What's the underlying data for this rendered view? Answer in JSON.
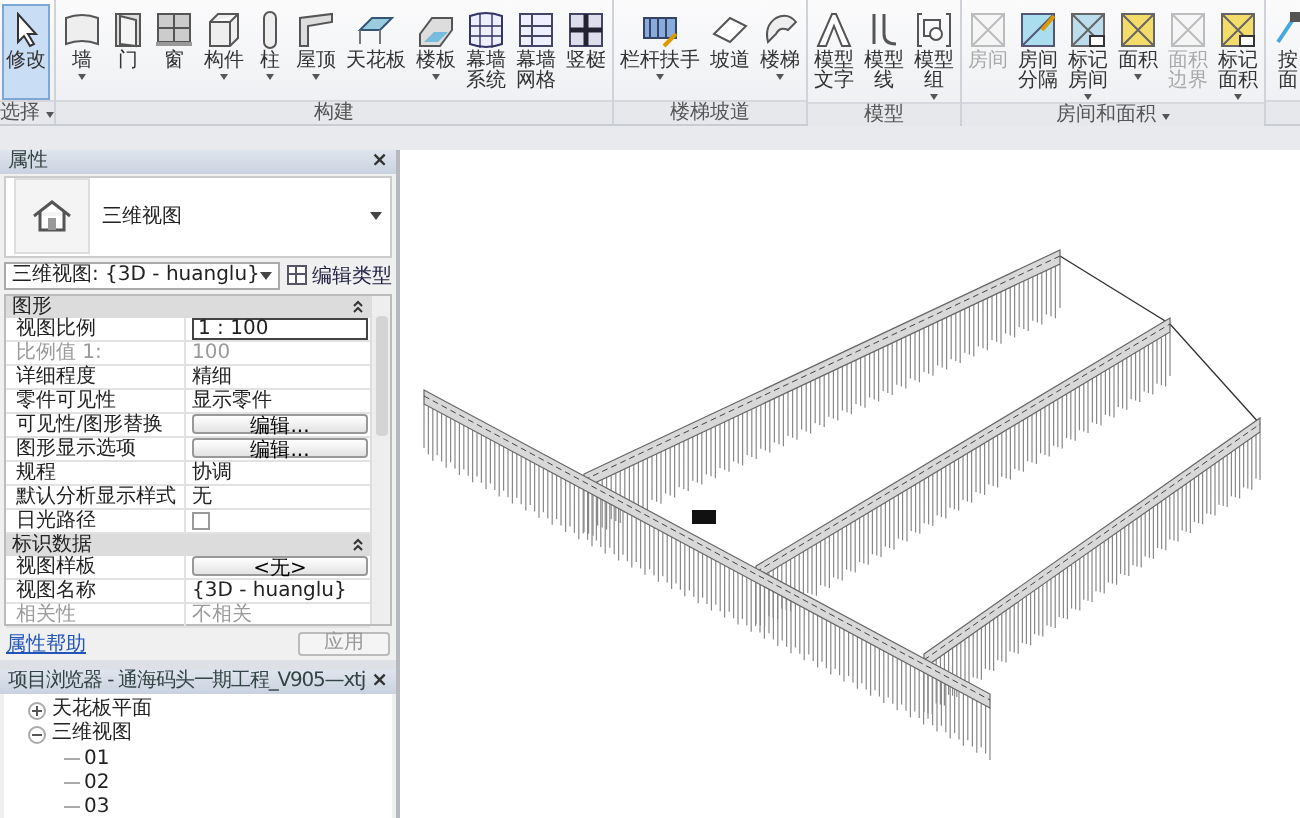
{
  "ribbon": {
    "groups": [
      {
        "label": "选择",
        "dropdown": true,
        "items": [
          {
            "label": [
              "修改"
            ],
            "selected": true,
            "disabled": false,
            "dropdown": false
          }
        ]
      },
      {
        "label": "构建",
        "items": [
          {
            "label": [
              "墙"
            ],
            "selected": false,
            "disabled": false,
            "dropdown": true
          },
          {
            "label": [
              "门"
            ],
            "selected": false,
            "disabled": false,
            "dropdown": false
          },
          {
            "label": [
              "窗"
            ],
            "selected": false,
            "disabled": false,
            "dropdown": false
          },
          {
            "label": [
              "构件"
            ],
            "selected": false,
            "disabled": false,
            "dropdown": true
          },
          {
            "label": [
              "柱"
            ],
            "selected": false,
            "disabled": false,
            "dropdown": true
          },
          {
            "label": [
              "屋顶"
            ],
            "selected": false,
            "disabled": false,
            "dropdown": true
          },
          {
            "label": [
              "天花板"
            ],
            "selected": false,
            "disabled": false,
            "dropdown": false
          },
          {
            "label": [
              "楼板"
            ],
            "selected": false,
            "disabled": false,
            "dropdown": true
          },
          {
            "label": [
              "幕墙",
              "系统"
            ],
            "selected": false,
            "disabled": false,
            "dropdown": false
          },
          {
            "label": [
              "幕墙",
              "网格"
            ],
            "selected": false,
            "disabled": false,
            "dropdown": false
          },
          {
            "label": [
              "竖梃"
            ],
            "selected": false,
            "disabled": false,
            "dropdown": false
          }
        ]
      },
      {
        "label": "楼梯坡道",
        "items": [
          {
            "label": [
              "栏杆扶手"
            ],
            "selected": false,
            "disabled": false,
            "dropdown": true
          },
          {
            "label": [
              "坡道"
            ],
            "selected": false,
            "disabled": false,
            "dropdown": false
          },
          {
            "label": [
              "楼梯"
            ],
            "selected": false,
            "disabled": false,
            "dropdown": true
          }
        ]
      },
      {
        "label": "模型",
        "items": [
          {
            "label": [
              "模型",
              "文字"
            ],
            "selected": false,
            "disabled": false,
            "dropdown": false
          },
          {
            "label": [
              "模型",
              "线"
            ],
            "selected": false,
            "disabled": false,
            "dropdown": false
          },
          {
            "label": [
              "模型",
              "组"
            ],
            "selected": false,
            "disabled": false,
            "dropdown": true
          }
        ]
      },
      {
        "label": "房间和面积",
        "dropdown": true,
        "items": [
          {
            "label": [
              "房间"
            ],
            "selected": false,
            "disabled": true,
            "dropdown": false
          },
          {
            "label": [
              "房间",
              "分隔"
            ],
            "selected": false,
            "disabled": false,
            "dropdown": false
          },
          {
            "label": [
              "标记",
              "房间"
            ],
            "selected": false,
            "disabled": false,
            "dropdown": true
          },
          {
            "label": [
              "面积"
            ],
            "selected": false,
            "disabled": false,
            "dropdown": true
          },
          {
            "label": [
              "面积",
              "边界"
            ],
            "selected": false,
            "disabled": true,
            "dropdown": false
          },
          {
            "label": [
              "标记",
              "面积"
            ],
            "selected": false,
            "disabled": false,
            "dropdown": true
          }
        ]
      },
      {
        "items": [
          {
            "label": [
              "按",
              "面"
            ],
            "selected": false,
            "disabled": false,
            "dropdown": false
          }
        ]
      }
    ]
  },
  "properties": {
    "title": "属性",
    "close": "×",
    "type_name": "三维视图",
    "view_selector": "三维视图: {3D - huanglu}",
    "edit_type": "编辑类型",
    "sections": [
      {
        "title": "图形",
        "rows": [
          {
            "kind": "field",
            "label": "视图比例",
            "value": "1 : 100",
            "disabled": false
          },
          {
            "kind": "text",
            "label": "比例值 1:",
            "value": "100",
            "disabled": true
          },
          {
            "kind": "text",
            "label": "详细程度",
            "value": "精细",
            "disabled": false
          },
          {
            "kind": "text",
            "label": "零件可见性",
            "value": "显示零件",
            "disabled": false
          },
          {
            "kind": "button",
            "label": "可见性/图形替换",
            "value": "编辑...",
            "disabled": false
          },
          {
            "kind": "button",
            "label": "图形显示选项",
            "value": "编辑...",
            "disabled": false
          },
          {
            "kind": "text",
            "label": "规程",
            "value": "协调",
            "disabled": false
          },
          {
            "kind": "text",
            "label": "默认分析显示样式",
            "value": "无",
            "disabled": false
          },
          {
            "kind": "checkbox",
            "label": "日光路径",
            "checked": false,
            "disabled": false
          }
        ]
      },
      {
        "title": "标识数据",
        "rows": [
          {
            "kind": "button",
            "label": "视图样板",
            "value": "<无>",
            "disabled": false
          },
          {
            "kind": "text",
            "label": "视图名称",
            "value": "{3D - huanglu}",
            "disabled": false
          },
          {
            "kind": "text",
            "label": "相关性",
            "value": "不相关",
            "disabled": true
          }
        ]
      }
    ],
    "help_link": "属性帮助",
    "apply": "应用"
  },
  "project_browser": {
    "title": "项目浏览器 - 通海码头一期工程_V905—xtj",
    "close": "×",
    "tree": [
      {
        "label": "天花板平面",
        "expanded": false
      },
      {
        "label": "三维视图",
        "expanded": true,
        "children": [
          {
            "label": "01"
          },
          {
            "label": "02"
          },
          {
            "label": "03"
          }
        ]
      }
    ]
  }
}
